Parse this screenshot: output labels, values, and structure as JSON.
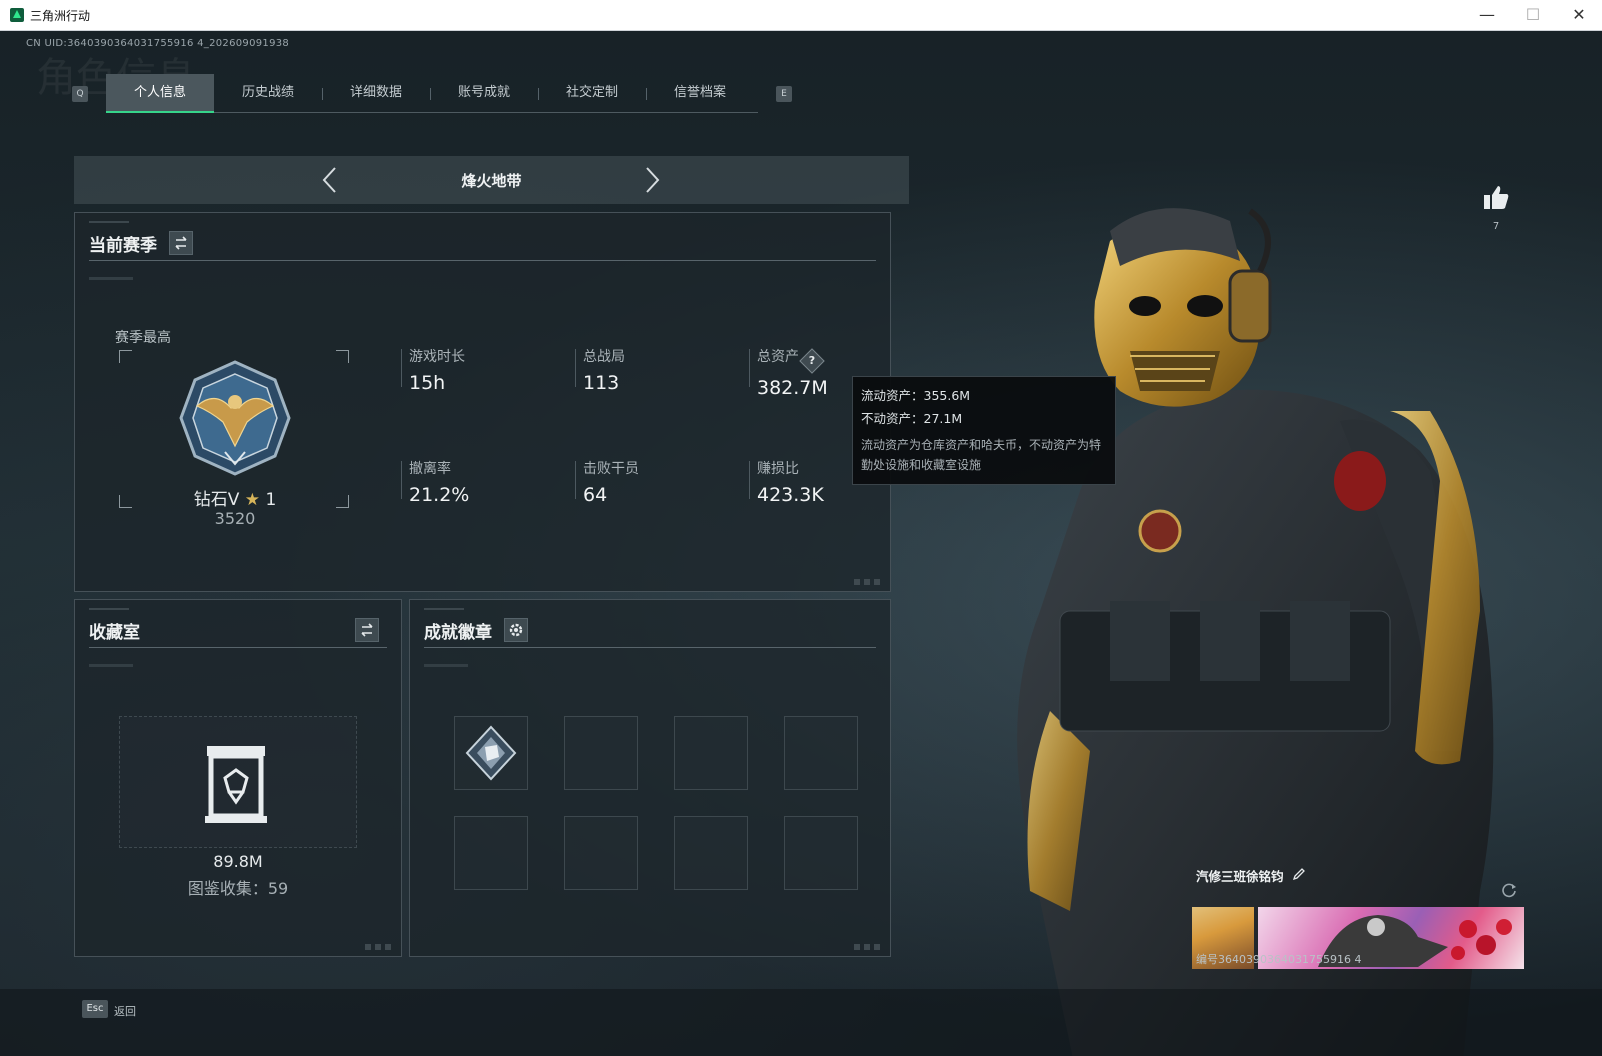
{
  "window": {
    "title": "三角洲行动",
    "minimize": "—",
    "maximize": "☐",
    "close": "✕"
  },
  "uid": "CN UID:3640390364031755916 4_202609091938",
  "ghost_title": "角色信息",
  "tabs": {
    "q_key": "Q",
    "e_key": "E",
    "items": [
      "个人信息",
      "历史战绩",
      "详细数据",
      "账号成就",
      "社交定制",
      "信誉档案"
    ],
    "active_index": 0
  },
  "mode": {
    "label": "烽火地带"
  },
  "season": {
    "title": "当前赛季",
    "best_label": "赛季最高",
    "rank_name": "钻石V",
    "rank_star": "★",
    "rank_stars": "1",
    "rank_score": "3520",
    "stats": [
      {
        "label": "游戏时长",
        "value": "15h"
      },
      {
        "label": "总战局",
        "value": "113"
      },
      {
        "label": "总资产",
        "value": "382.7M",
        "help": "?"
      },
      {
        "label": "撤离率",
        "value": "21.2%"
      },
      {
        "label": "击败干员",
        "value": "64"
      },
      {
        "label": "赚损比",
        "value": "423.3K"
      }
    ]
  },
  "tooltip": {
    "line1": "流动资产：355.6M",
    "line2": "不动资产：27.1M",
    "desc": "流动资产为仓库资产和哈夫币，不动资产为特勤处设施和收藏室设施"
  },
  "collection": {
    "title": "收藏室",
    "value": "89.8M",
    "count_text": "图鉴收集：59"
  },
  "badges": {
    "title": "成就徽章",
    "slots": 8,
    "filled": 1
  },
  "profile": {
    "likes": "7",
    "name": "汽修三班徐铭钧",
    "id_text": "编号3640390364031755916 4"
  },
  "footer": {
    "esc_key": "Esc",
    "back_label": "返回"
  },
  "colors": {
    "accent": "#36d48a",
    "gold": "#d7b55a",
    "panel_border": "#465158"
  }
}
